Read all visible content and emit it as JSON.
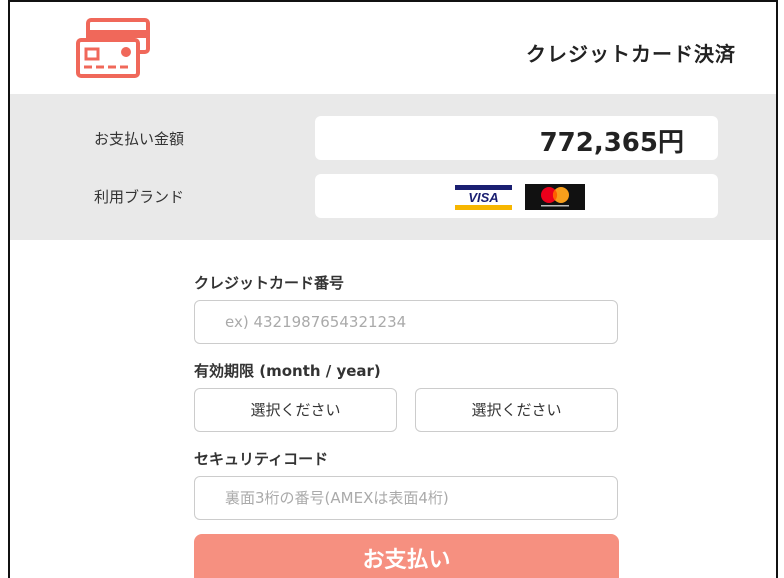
{
  "header": {
    "title": "クレジットカード決済",
    "icon": "credit-card-icon"
  },
  "summary": {
    "amount_label": "お支払い金額",
    "amount_value": "772,365円",
    "brand_label": "利用ブランド",
    "brands": [
      {
        "name": "VISA",
        "icon": "visa-logo"
      },
      {
        "name": "mastercard",
        "icon": "mastercard-logo"
      }
    ]
  },
  "form": {
    "card_number_label": "クレジットカード番号",
    "card_number_placeholder": "ex) 4321987654321234",
    "expiry_label": "有効期限 (month / year)",
    "month_selected": "選択ください",
    "year_selected": "選択ください",
    "security_code_label": "セキュリティコード",
    "security_code_placeholder": "裏面3桁の番号(AMEXは表面4桁)",
    "submit_label": "お支払い"
  },
  "colors": {
    "accent": "#f0685a",
    "button": "#f69080",
    "summary_bg": "#e9e9e9"
  }
}
